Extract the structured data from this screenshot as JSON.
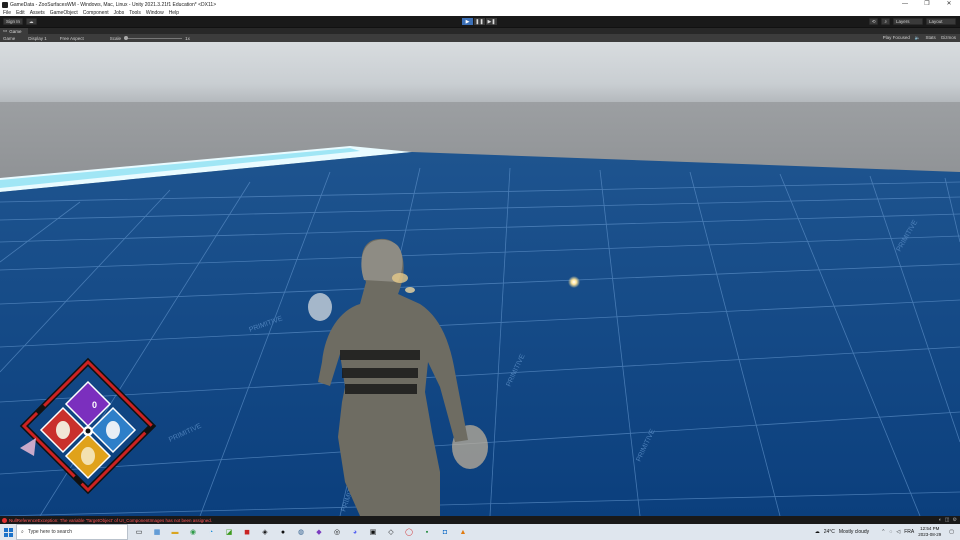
{
  "window": {
    "title": "GameData - ZooSurfacesWM - Windows, Mac, Linux - Unity 2021.3.21f1 Education* <DX11>",
    "controls": [
      "—",
      "❐",
      "✕"
    ]
  },
  "menu": [
    "File",
    "Edit",
    "Assets",
    "GameObject",
    "Component",
    "Jobs",
    "Tools",
    "Window",
    "Help"
  ],
  "toolbar": {
    "account": "Sign In",
    "cloud": "☁",
    "play": "▶",
    "pause": "❚❚",
    "step": "▶❚",
    "layers": "Layers",
    "layout": "Layout"
  },
  "tabs": {
    "game": "Game"
  },
  "gamebar": {
    "view": "Game",
    "display": "Display 1",
    "aspect": "Free Aspect",
    "scale_label": "Scale",
    "scale_value": "1x",
    "play_mode": "Play Focused",
    "mute": "🔈",
    "stats": "Stats",
    "gizmos": "Gizmos"
  },
  "hud": {
    "counter": "0"
  },
  "scene": {
    "floor_labels": [
      "PRIMITIVE",
      "PRIMITIVE",
      "PRIMITIVE",
      "PRIMITIVE",
      "PRIMITIVE",
      "PRIMITIVE"
    ]
  },
  "status": {
    "message": "NullReferenceException: The variable 'TargetObject' of UI_ComponentImages has not been assigned."
  },
  "taskbar": {
    "search_placeholder": "Type here to search",
    "weather_temp": "24°C",
    "weather_text": "Mostly cloudy",
    "lang": "FRA",
    "time": "12:54 PM",
    "date": "2023-08-29"
  },
  "colors": {
    "floor": "#114a8a",
    "sky": "#c9ced2",
    "hud_purple": "#7b2fbe",
    "hud_red": "#c9302c",
    "hud_blue": "#2e7fc9",
    "hud_yellow": "#e0a21b",
    "play_active": "#3b6fb6"
  }
}
